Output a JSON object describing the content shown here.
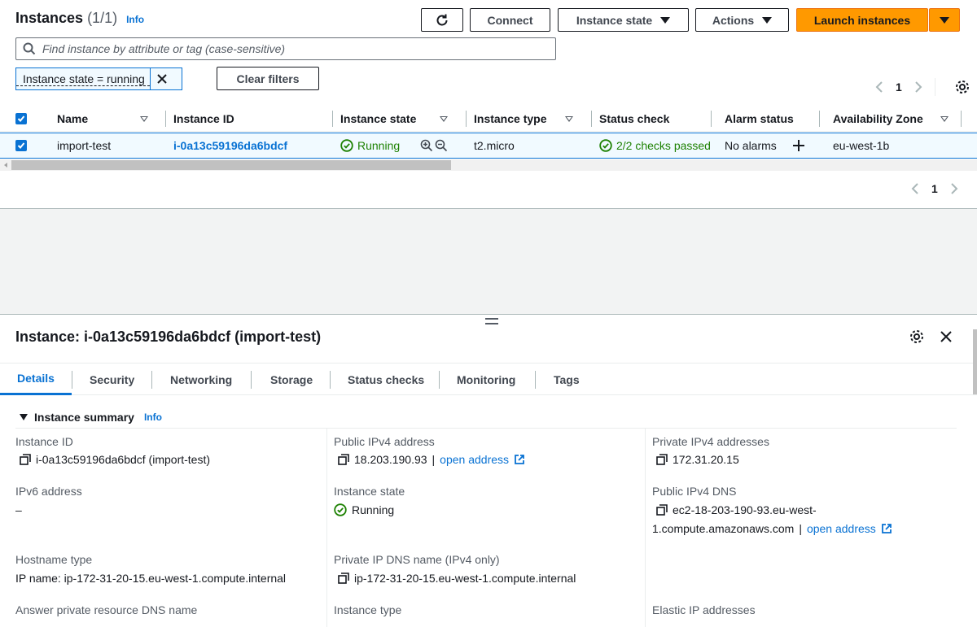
{
  "header": {
    "title": "Instances",
    "count": "(1/1)",
    "info": "Info",
    "connect": "Connect",
    "instance_state": "Instance state",
    "actions": "Actions",
    "launch": "Launch instances"
  },
  "search": {
    "placeholder": "Find instance by attribute or tag (case-sensitive)"
  },
  "filter": {
    "token": "Instance state = running",
    "clear": "Clear filters"
  },
  "pagination": {
    "page": "1"
  },
  "table": {
    "columns": [
      "Name",
      "Instance ID",
      "Instance state",
      "Instance type",
      "Status check",
      "Alarm status",
      "Availability Zone"
    ],
    "row": {
      "name": "import-test",
      "instance_id": "i-0a13c59196da6bdcf",
      "state": "Running",
      "type": "t2.micro",
      "status_check": "2/2 checks passed",
      "alarm": "No alarms",
      "az": "eu-west-1b"
    }
  },
  "details": {
    "title": "Instance: i-0a13c59196da6bdcf (import-test)",
    "tabs": [
      "Details",
      "Security",
      "Networking",
      "Storage",
      "Status checks",
      "Monitoring",
      "Tags"
    ],
    "summary": "Instance summary",
    "info": "Info",
    "fields": {
      "instance_id_label": "Instance ID",
      "instance_id_value": "i-0a13c59196da6bdcf (import-test)",
      "public_ipv4_label": "Public IPv4 address",
      "public_ipv4_value": "18.203.190.93",
      "open_address": "open address",
      "private_ipv4_label": "Private IPv4 addresses",
      "private_ipv4_value": "172.31.20.15",
      "ipv6_label": "IPv6 address",
      "ipv6_value": "–",
      "state_label": "Instance state",
      "state_value": "Running",
      "public_dns_label": "Public IPv4 DNS",
      "public_dns_line1": "ec2-18-203-190-93.eu-west-",
      "public_dns_line2": "1.compute.amazonaws.com",
      "hostname_label": "Hostname type",
      "hostname_value": "IP name: ip-172-31-20-15.eu-west-1.compute.internal",
      "private_dns_label": "Private IP DNS name (IPv4 only)",
      "private_dns_value": "ip-172-31-20-15.eu-west-1.compute.internal",
      "answer_dns_label": "Answer private resource DNS name",
      "instance_type_label": "Instance type",
      "elastic_ip_label": "Elastic IP addresses"
    }
  },
  "colors": {
    "accent": "#0972d3",
    "orange": "#ff9900",
    "success": "#1d8102"
  }
}
